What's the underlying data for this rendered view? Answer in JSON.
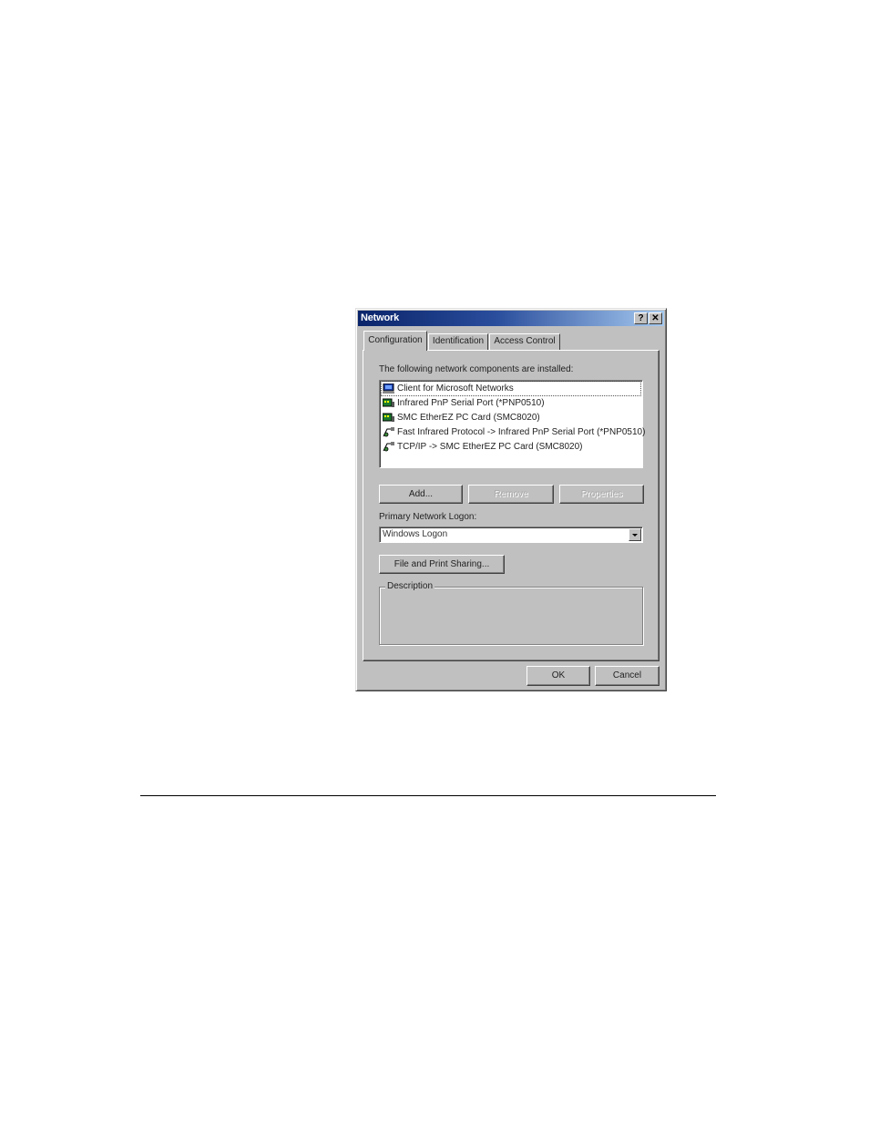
{
  "window": {
    "title": "Network",
    "help_button": "?",
    "close_button": "✕"
  },
  "tabs": [
    {
      "label": "Configuration",
      "active": true
    },
    {
      "label": "Identification",
      "active": false
    },
    {
      "label": "Access Control",
      "active": false
    }
  ],
  "configuration": {
    "components_label": "The following network components are installed:",
    "components": [
      {
        "label": "Client for Microsoft Networks",
        "icon": "client-icon",
        "selected": true
      },
      {
        "label": "Infrared PnP Serial Port (*PNP0510)",
        "icon": "adapter-icon",
        "selected": false
      },
      {
        "label": "SMC EtherEZ PC Card (SMC8020)",
        "icon": "adapter-icon",
        "selected": false
      },
      {
        "label": "Fast Infrared Protocol -> Infrared PnP Serial Port (*PNP0510)",
        "icon": "protocol-icon",
        "selected": false
      },
      {
        "label": "TCP/IP -> SMC EtherEZ PC Card (SMC8020)",
        "icon": "protocol-icon",
        "selected": false
      }
    ],
    "add_label": "Add...",
    "remove_label": "Remove",
    "properties_label": "Properties",
    "logon_label": "Primary Network Logon:",
    "logon_value": "Windows Logon",
    "file_print_label": "File and Print Sharing...",
    "description_label": "Description"
  },
  "footer": {
    "ok_label": "OK",
    "cancel_label": "Cancel"
  },
  "colors": {
    "face": "#c0c0c0",
    "titlebar_start": "#0a246a",
    "titlebar_end": "#a6caf0"
  }
}
